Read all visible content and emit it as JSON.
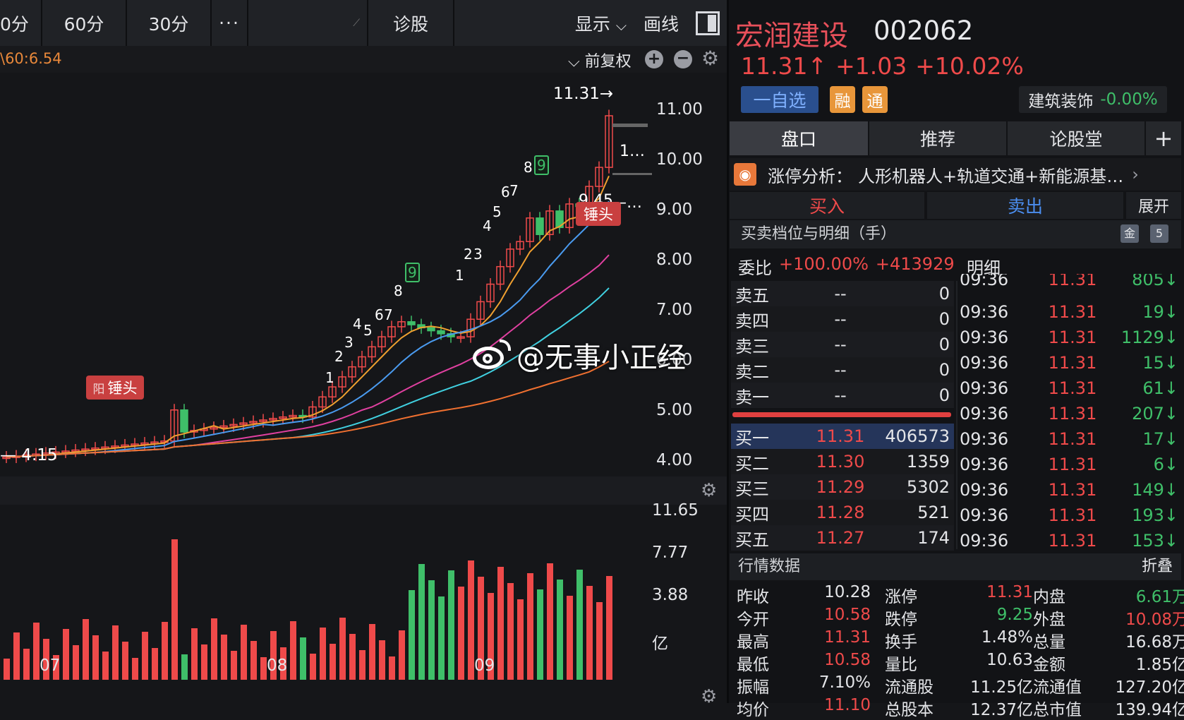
{
  "toolbar": {
    "t0": "0分",
    "t1": "60分",
    "t2": "30分",
    "more": "···",
    "diag": "诊股",
    "show": "显示",
    "draw": "画线"
  },
  "chart_header": {
    "ma_label": "\\60:6.54",
    "adjust": "前复权"
  },
  "price_axis": [
    "11.00",
    "10.00",
    "9.00",
    "8.00",
    "7.00",
    "6.00",
    "5.00",
    "4.00"
  ],
  "price_labels": {
    "high": "11.31→",
    "low": "— 4.15",
    "mid": "1…",
    "ma": "9.45",
    "ma_dots": "—…"
  },
  "tags": {
    "hammer1": "锤头",
    "hammer2": "锤头",
    "left_char": "阳"
  },
  "td_counts": [
    "1",
    "2",
    "3",
    "4",
    "5",
    "6",
    "7",
    "8",
    "9",
    "1",
    "2",
    "3",
    "4",
    "5",
    "6",
    "7",
    "8",
    "9",
    "1",
    "2",
    "3",
    "4",
    "5",
    "6",
    "7",
    "8",
    "9"
  ],
  "volume_axis": [
    "11.65",
    "7.77",
    "3.88",
    "亿"
  ],
  "x_axis": [
    "07",
    "08",
    "09"
  ],
  "watermark": "@无事小正经",
  "stock": {
    "name": "宏润建设",
    "code": "002062",
    "price": "11.31↑",
    "change": "+1.03",
    "pct": "+10.02%",
    "watch": "一自选",
    "badge1": "融",
    "badge2": "通",
    "sector": "建筑装饰",
    "sector_pct": "-0.00%"
  },
  "tabs": [
    "盘口",
    "推荐",
    "论股堂",
    "+"
  ],
  "analysis": {
    "label": "涨停分析：",
    "text": "人形机器人+轨道交通+新能源基…"
  },
  "trade_tabs": {
    "buy": "买入",
    "sell": "卖出",
    "expand": "展开"
  },
  "section": {
    "title": "买卖档位与明细（手）",
    "icon1": "金",
    "icon2": "5"
  },
  "ratio": {
    "label": "委比",
    "pct": "+100.00%",
    "diff": "+413929",
    "detail": "明细"
  },
  "sells": [
    {
      "n": "卖五",
      "p": "--",
      "v": "0"
    },
    {
      "n": "卖四",
      "p": "--",
      "v": "0"
    },
    {
      "n": "卖三",
      "p": "--",
      "v": "0"
    },
    {
      "n": "卖二",
      "p": "--",
      "v": "0"
    },
    {
      "n": "卖一",
      "p": "--",
      "v": "0"
    }
  ],
  "buys": [
    {
      "n": "买一",
      "p": "11.31",
      "v": "406573"
    },
    {
      "n": "买二",
      "p": "11.30",
      "v": "1359"
    },
    {
      "n": "买三",
      "p": "11.29",
      "v": "5302"
    },
    {
      "n": "买四",
      "p": "11.28",
      "v": "521"
    },
    {
      "n": "买五",
      "p": "11.27",
      "v": "174"
    }
  ],
  "trades": [
    {
      "t": "09:36",
      "p": "11.31",
      "v": "805↓"
    },
    {
      "t": "09:36",
      "p": "11.31",
      "v": "19↓"
    },
    {
      "t": "09:36",
      "p": "11.31",
      "v": "1129↓"
    },
    {
      "t": "09:36",
      "p": "11.31",
      "v": "15↓"
    },
    {
      "t": "09:36",
      "p": "11.31",
      "v": "61↓"
    },
    {
      "t": "09:36",
      "p": "11.31",
      "v": "207↓"
    },
    {
      "t": "09:36",
      "p": "11.31",
      "v": "17↓"
    },
    {
      "t": "09:36",
      "p": "11.31",
      "v": "6↓"
    },
    {
      "t": "09:36",
      "p": "11.31",
      "v": "149↓"
    },
    {
      "t": "09:36",
      "p": "11.31",
      "v": "193↓"
    },
    {
      "t": "09:36",
      "p": "11.31",
      "v": "153↓"
    }
  ],
  "quote_header": {
    "title": "行情数据",
    "fold": "折叠"
  },
  "quote": [
    [
      {
        "k": "昨收",
        "v": "10.28",
        "c": ""
      },
      {
        "k": "涨停",
        "v": "11.31",
        "c": "red"
      },
      {
        "k": "内盘",
        "v": "6.61万",
        "c": "green"
      }
    ],
    [
      {
        "k": "今开",
        "v": "10.58",
        "c": "red"
      },
      {
        "k": "跌停",
        "v": "9.25",
        "c": "green"
      },
      {
        "k": "外盘",
        "v": "10.08万",
        "c": "red"
      }
    ],
    [
      {
        "k": "最高",
        "v": "11.31",
        "c": "red"
      },
      {
        "k": "换手",
        "v": "1.48%",
        "c": ""
      },
      {
        "k": "总量",
        "v": "16.68万",
        "c": ""
      }
    ],
    [
      {
        "k": "最低",
        "v": "10.58",
        "c": "red"
      },
      {
        "k": "量比",
        "v": "10.63",
        "c": ""
      },
      {
        "k": "金额",
        "v": "1.85亿",
        "c": ""
      }
    ],
    [
      {
        "k": "振幅",
        "v": "7.10%",
        "c": ""
      },
      {
        "k": "流通股",
        "v": "11.25亿",
        "c": ""
      },
      {
        "k": "流通值",
        "v": "127.20亿",
        "c": ""
      }
    ],
    [
      {
        "k": "均价",
        "v": "11.10",
        "c": "red"
      },
      {
        "k": "总股本",
        "v": "12.37亿",
        "c": ""
      },
      {
        "k": "总市值",
        "v": "139.94亿",
        "c": ""
      }
    ]
  ],
  "colors": {
    "up": "#ef4a4a",
    "down": "#3fbf69",
    "accent": "#d73a3a"
  }
}
